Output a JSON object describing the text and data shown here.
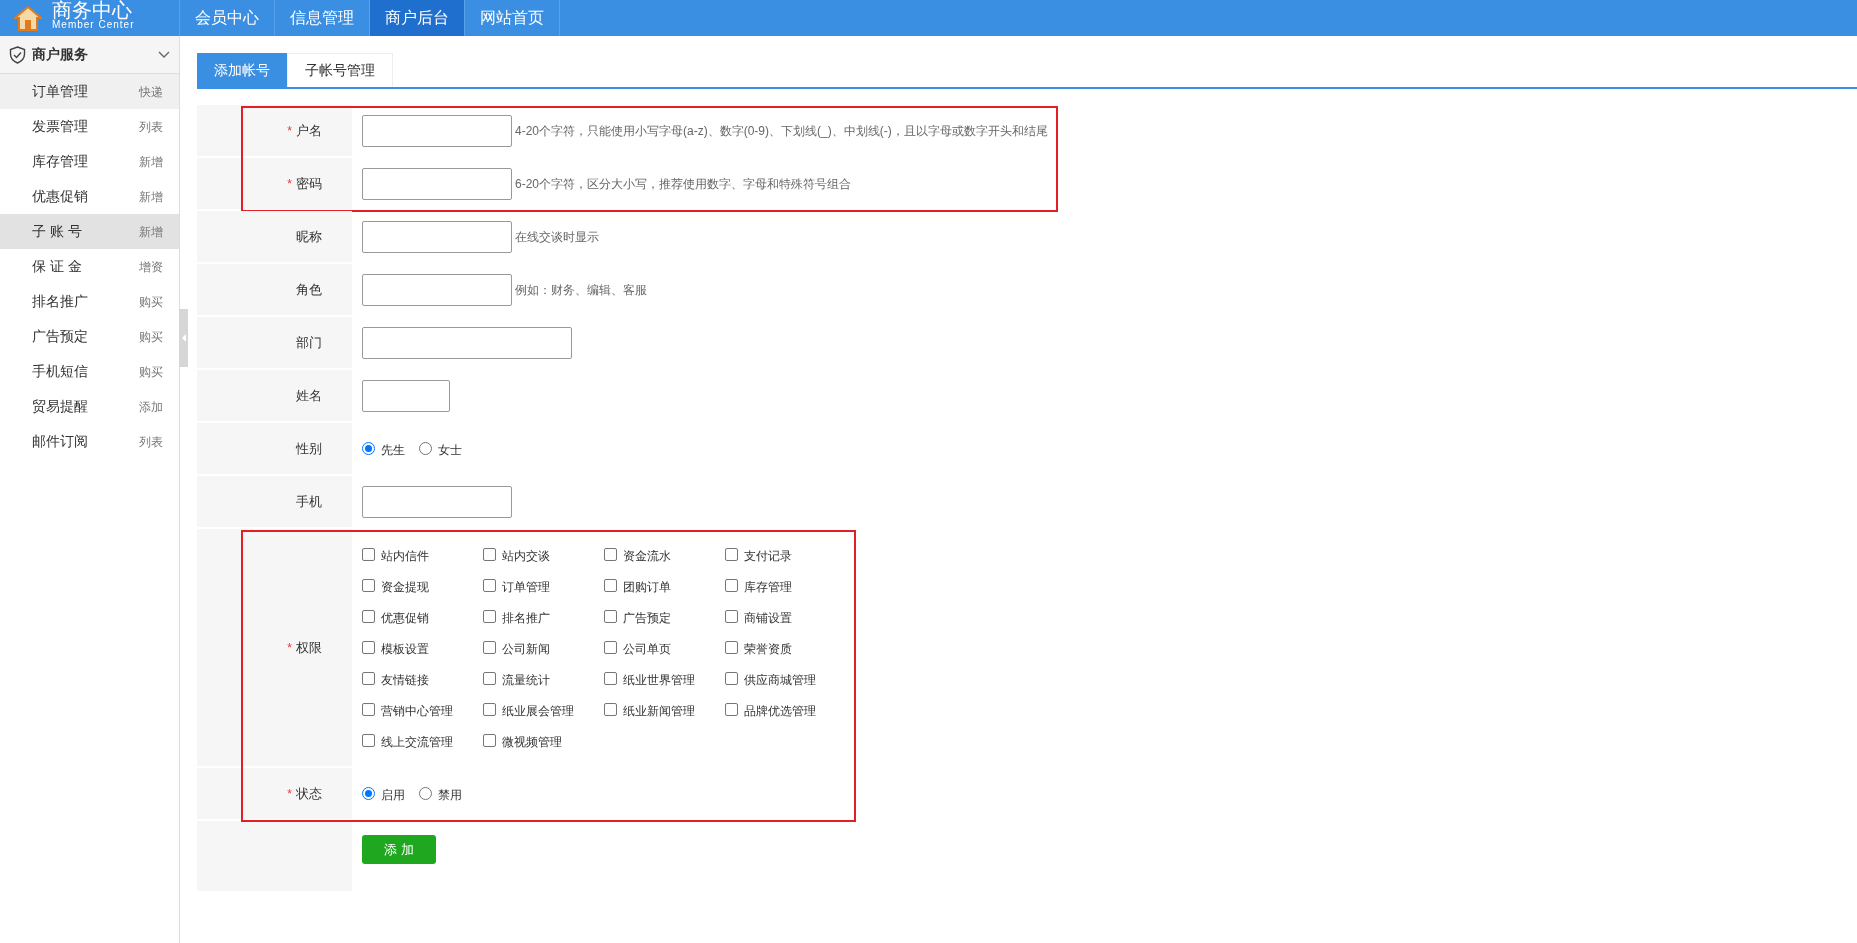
{
  "header": {
    "logo_title": "商务中心",
    "logo_subtitle": "Member Center",
    "nav": [
      {
        "label": "会员中心",
        "selected": false
      },
      {
        "label": "信息管理",
        "selected": false
      },
      {
        "label": "商户后台",
        "selected": true
      },
      {
        "label": "网站首页",
        "selected": false
      }
    ]
  },
  "sidebar": {
    "title": "商户服务",
    "expanded": true,
    "items": [
      {
        "label": "订单管理",
        "tag": "快递",
        "selected": false,
        "hovered": true
      },
      {
        "label": "发票管理",
        "tag": "列表",
        "selected": false,
        "hovered": false
      },
      {
        "label": "库存管理",
        "tag": "新增",
        "selected": false,
        "hovered": false
      },
      {
        "label": "优惠促销",
        "tag": "新增",
        "selected": false,
        "hovered": false
      },
      {
        "label": "子 账 号",
        "tag": "新增",
        "selected": true,
        "hovered": false
      },
      {
        "label": "保 证 金",
        "tag": "增资",
        "selected": false,
        "hovered": false
      },
      {
        "label": "排名推广",
        "tag": "购买",
        "selected": false,
        "hovered": false
      },
      {
        "label": "广告预定",
        "tag": "购买",
        "selected": false,
        "hovered": false
      },
      {
        "label": "手机短信",
        "tag": "购买",
        "selected": false,
        "hovered": false
      },
      {
        "label": "贸易提醒",
        "tag": "添加",
        "selected": false,
        "hovered": false
      },
      {
        "label": "邮件订阅",
        "tag": "列表",
        "selected": false,
        "hovered": false
      }
    ]
  },
  "tabs": [
    {
      "label": "添加帐号",
      "selected": true
    },
    {
      "label": "子帐号管理",
      "selected": false
    }
  ],
  "form": {
    "groups": [
      {
        "highlighted": true,
        "rows": [
          {
            "kind": "text",
            "label": "户名",
            "marker": "*",
            "hint": "4-20个字符，只能使用小写字母(a-z)、数字(0-9)、下划线(_)、中划线(-)，且以字母或数字开头和结尾"
          },
          {
            "kind": "text",
            "label": "密码",
            "marker": "*",
            "hint": "6-20个字符，区分大小写，推荐使用数字、字母和特殊符号组合"
          }
        ]
      },
      {
        "highlighted": false,
        "rows": [
          {
            "kind": "text",
            "label": "昵称",
            "hint": "在线交谈时显示"
          },
          {
            "kind": "text",
            "label": "角色",
            "hint": "例如：财务、编辑、客服"
          },
          {
            "kind": "wide",
            "label": "部门"
          },
          {
            "kind": "short",
            "label": "姓名"
          },
          {
            "kind": "radio",
            "label": "性别",
            "options": [
              {
                "label": "先生",
                "selected": true
              },
              {
                "label": "女士",
                "selected": false
              }
            ]
          },
          {
            "kind": "text",
            "label": "手机"
          }
        ]
      },
      {
        "highlighted": true,
        "rows": [
          {
            "kind": "checkbox",
            "label": "权限",
            "marker": "*",
            "options": [
              {
                "label": "站内信件",
                "checked": false
              },
              {
                "label": "站内交谈",
                "checked": false
              },
              {
                "label": "资金流水",
                "checked": false
              },
              {
                "label": "支付记录",
                "checked": false
              },
              {
                "label": "资金提现",
                "checked": false
              },
              {
                "label": "订单管理",
                "checked": false
              },
              {
                "label": "团购订单",
                "checked": false
              },
              {
                "label": "库存管理",
                "checked": false
              },
              {
                "label": "优惠促销",
                "checked": false
              },
              {
                "label": "排名推广",
                "checked": false
              },
              {
                "label": "广告预定",
                "checked": false
              },
              {
                "label": "商铺设置",
                "checked": false
              },
              {
                "label": "模板设置",
                "checked": false
              },
              {
                "label": "公司新闻",
                "checked": false
              },
              {
                "label": "公司单页",
                "checked": false
              },
              {
                "label": "荣誉资质",
                "checked": false
              },
              {
                "label": "友情链接",
                "checked": false
              },
              {
                "label": "流量统计",
                "checked": false
              },
              {
                "label": "纸业世界管理",
                "checked": false
              },
              {
                "label": "供应商城管理",
                "checked": false
              },
              {
                "label": "营销中心管理",
                "checked": false
              },
              {
                "label": "纸业展会管理",
                "checked": false
              },
              {
                "label": "纸业新闻管理",
                "checked": false
              },
              {
                "label": "品牌优选管理",
                "checked": false
              },
              {
                "label": "线上交流管理",
                "checked": false
              },
              {
                "label": "微视频管理",
                "checked": false
              }
            ]
          },
          {
            "kind": "radio",
            "label": "状态",
            "marker": "*",
            "options": [
              {
                "label": "启用",
                "selected": true
              },
              {
                "label": "禁用",
                "selected": false
              }
            ]
          }
        ]
      }
    ],
    "submit": "添 加"
  }
}
